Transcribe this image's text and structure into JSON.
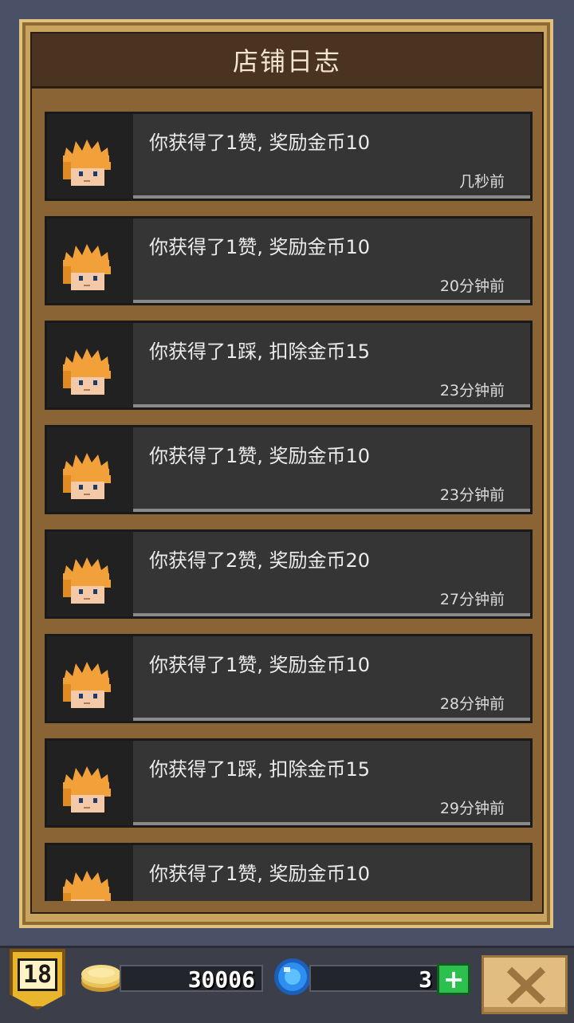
{
  "panel": {
    "title": "店铺日志"
  },
  "entries": [
    {
      "text": "你获得了1赞, 奖励金币10",
      "time": "几秒前"
    },
    {
      "text": "你获得了1赞, 奖励金币10",
      "time": "20分钟前"
    },
    {
      "text": "你获得了1踩, 扣除金币15",
      "time": "23分钟前"
    },
    {
      "text": "你获得了1赞, 奖励金币10",
      "time": "23分钟前"
    },
    {
      "text": "你获得了2赞, 奖励金币20",
      "time": "27分钟前"
    },
    {
      "text": "你获得了1赞, 奖励金币10",
      "time": "28分钟前"
    },
    {
      "text": "你获得了1踩, 扣除金币15",
      "time": "29分钟前"
    },
    {
      "text": "你获得了1赞, 奖励金币10",
      "time": ""
    }
  ],
  "status_bar": {
    "level": "18",
    "coins": "30006",
    "gems": "3",
    "plus_label": "+"
  },
  "colors": {
    "frame_gold": "#c9a45f",
    "title_bar": "#4a3320",
    "entry_bg": "#353535",
    "plus_green": "#2cc14d",
    "badge_gold": "#e8b52c"
  },
  "icons": {
    "avatar": "avatar-icon",
    "coin": "coin-icon",
    "gem": "gem-icon",
    "close": "close-icon"
  }
}
